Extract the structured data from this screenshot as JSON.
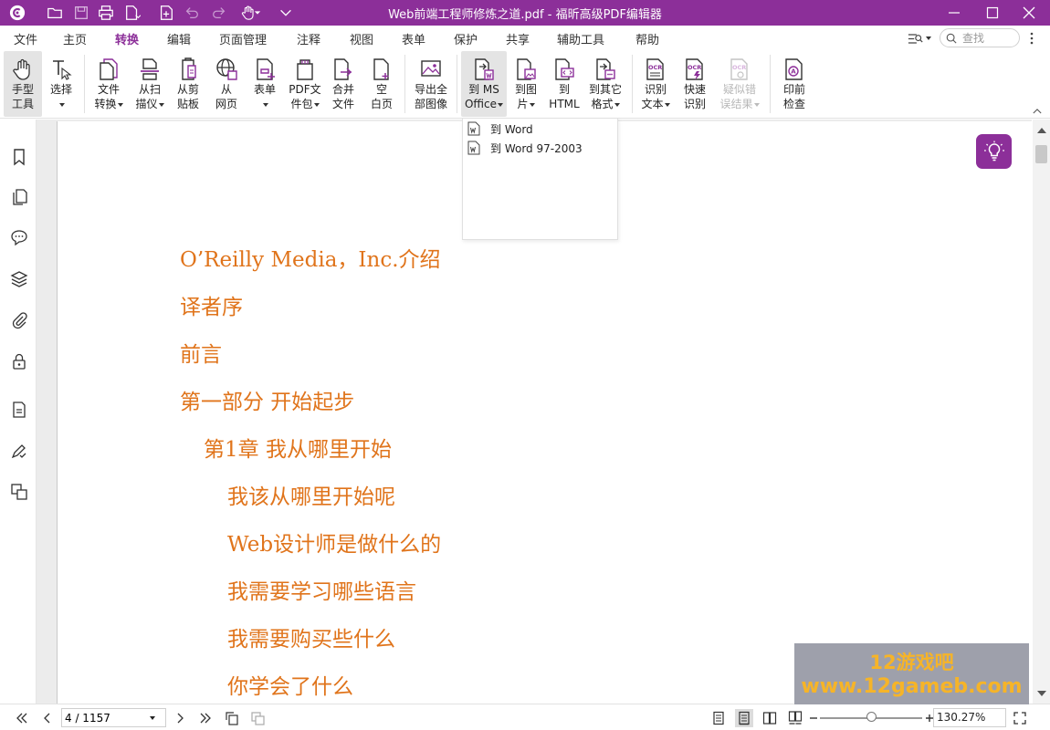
{
  "app": {
    "title": "Web前端工程师修炼之道.pdf - 福昕高级PDF编辑器",
    "brand_color": "#8c2f99"
  },
  "menu": {
    "items": [
      "文件",
      "主页",
      "转换",
      "编辑",
      "页面管理",
      "注释",
      "视图",
      "表单",
      "保护",
      "共享",
      "辅助工具",
      "帮助"
    ],
    "active": "转换"
  },
  "search": {
    "placeholder": "查找"
  },
  "ribbon": {
    "hand": [
      "手型",
      "工具"
    ],
    "select": [
      "选择"
    ],
    "file_convert": [
      "文件",
      "转换"
    ],
    "from_scanner": [
      "从扫",
      "描仪"
    ],
    "from_clipboard": [
      "从剪",
      "贴板"
    ],
    "from_web": [
      "从",
      "网页"
    ],
    "form": [
      "表单"
    ],
    "pdf_package": [
      "PDF文",
      "件包"
    ],
    "merge": [
      "合并",
      "文件"
    ],
    "blank": [
      "空",
      "白页"
    ],
    "export_images": [
      "导出全",
      "部图像"
    ],
    "to_ms_office": [
      "到 MS",
      "Office"
    ],
    "to_image": [
      "到图",
      "片"
    ],
    "to_html": [
      "到",
      "HTML"
    ],
    "to_other": [
      "到其它",
      "格式"
    ],
    "ocr_text": [
      "识别",
      "文本"
    ],
    "quick_ocr": [
      "快速",
      "识别"
    ],
    "suspect_results": [
      "疑似错",
      "误结果"
    ],
    "preflight": [
      "印前",
      "检查"
    ]
  },
  "office_dropdown": {
    "items": [
      "到 Word",
      "到 Word 97-2003"
    ]
  },
  "document": {
    "toc": [
      "O’Reilly Media，Inc.介绍",
      "译者序",
      "前言",
      "第一部分 开始起步",
      "第1章 我从哪里开始",
      "我该从哪里开始呢",
      "Web设计师是做什么的",
      "我需要学习哪些语言",
      "我需要购买些什么",
      "你学会了什么"
    ],
    "text_color": "#e0741b"
  },
  "status": {
    "page_value": "4 / 1157",
    "zoom_value": "130.27%",
    "zoom_level": 0.5
  },
  "watermark": {
    "line1": "12游戏吧",
    "line2": "www.12gameb.com"
  }
}
